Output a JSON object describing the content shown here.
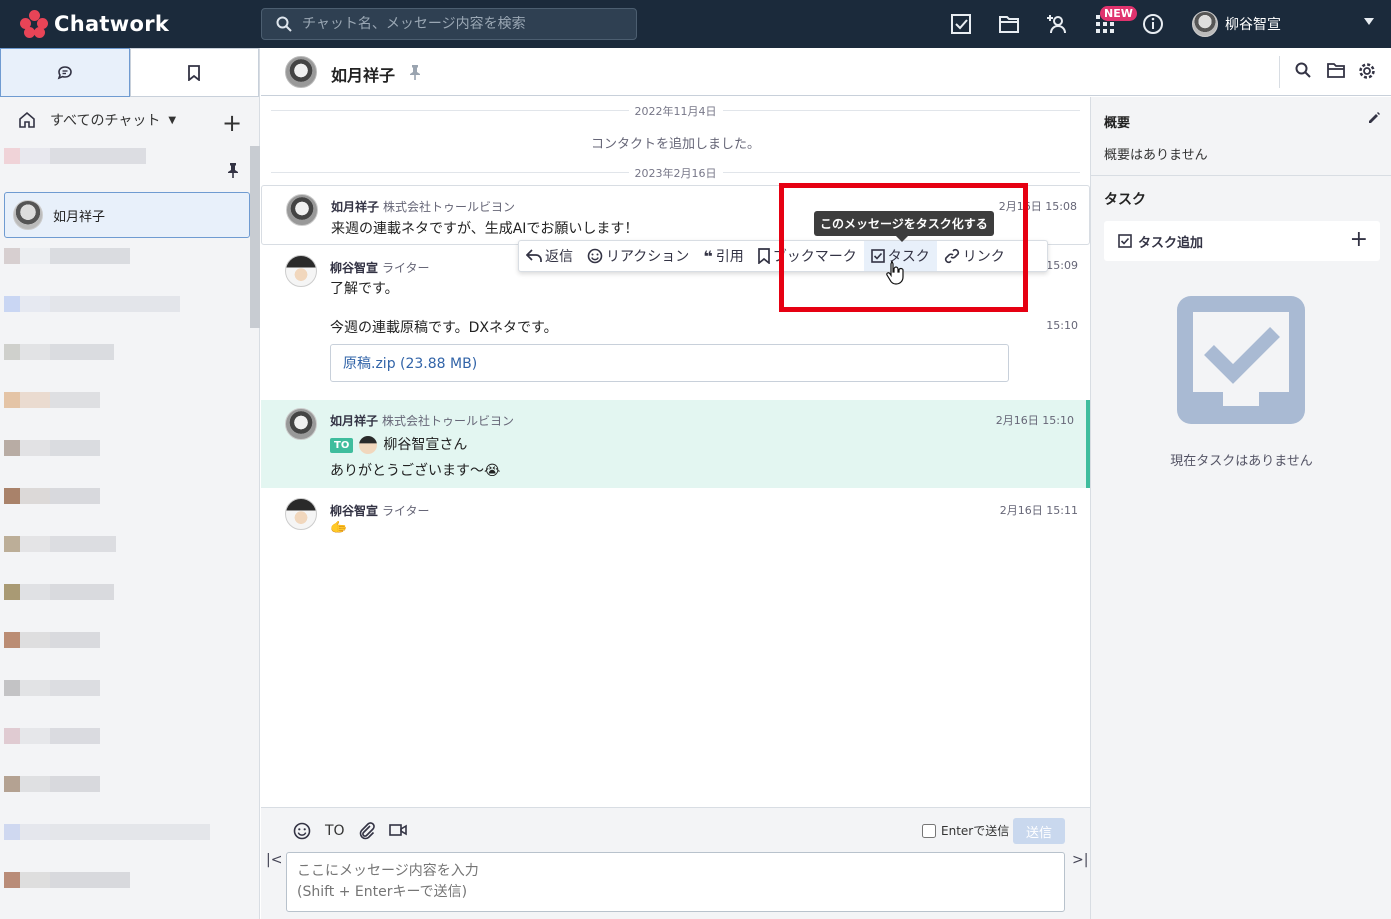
{
  "app": {
    "name": "Chatwork",
    "search_placeholder": "チャット名、メッセージ内容を検索",
    "new_badge": "NEW",
    "user_name": "柳谷智宣"
  },
  "sidebar": {
    "all_chats_label": "すべてのチャット",
    "selected_chat": "如月祥子"
  },
  "room": {
    "title": "如月祥子"
  },
  "timeline": {
    "date1": "2022年11月4日",
    "system_message": "コンタクトを追加しました。",
    "date2": "2023年2月16日",
    "messages": [
      {
        "name": "如月祥子",
        "org": "株式会社トゥールビヨン",
        "time": "2月16日 15:08",
        "body": "来週の連載ネタですが、生成AIでお願いします！"
      },
      {
        "name": "柳谷智宣",
        "org": "ライター",
        "time": "15:09",
        "body": "了解です。"
      },
      {
        "time": "15:10",
        "body": "今週の連載原稿です。DXネタです。",
        "file": "原稿.zip (23.88 MB)"
      },
      {
        "name": "如月祥子",
        "org": "株式会社トゥールビヨン",
        "time": "2月16日 15:10",
        "to_label": "TO",
        "to_name": "柳谷智宣さん",
        "body": "ありがとうございます〜😭"
      },
      {
        "name": "柳谷智宣",
        "org": "ライター",
        "time": "2月16日 15:11",
        "body": "🫱"
      }
    ]
  },
  "hover_actions": {
    "reply": "返信",
    "reaction": "リアクション",
    "quote": "引用",
    "bookmark": "ブックマーク",
    "task": "タスク",
    "link": "リンク",
    "more": "⋮",
    "tooltip": "このメッセージをタスク化する"
  },
  "composer": {
    "to_label": "TO",
    "enter_send_label": "Enterで送信",
    "send_label": "送信",
    "placeholder": "ここにメッセージ内容を入力\n(Shift + Enterキーで送信)"
  },
  "right_panel": {
    "summary_title": "概要",
    "summary_text": "概要はありません",
    "task_title": "タスク",
    "task_add_label": "タスク追加",
    "empty_text": "現在タスクはありません"
  },
  "colors": {
    "header_bg": "#1b2a3b",
    "accent_blue": "#3264a8",
    "highlight_green": "#3fbd9d",
    "annotation_red": "#e60012"
  }
}
